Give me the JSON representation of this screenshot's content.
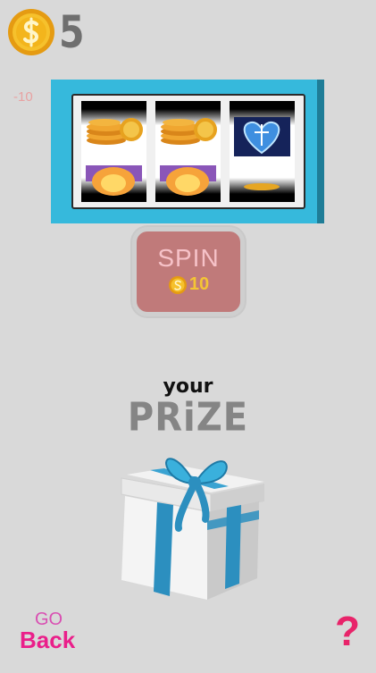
{
  "hud": {
    "coin_count": "5",
    "cost_float": "-10"
  },
  "slot_machine": {
    "reels": [
      {
        "icons": [
          "coins-icon",
          "sunset-icon"
        ]
      },
      {
        "icons": [
          "coins-icon",
          "sunset-icon"
        ]
      },
      {
        "icons": [
          "glowing-heart-icon",
          "coins-icon"
        ]
      }
    ]
  },
  "spin_button": {
    "label": "SPIN",
    "cost": "10"
  },
  "prize": {
    "heading": "your",
    "title": "PRiZE",
    "icon": "gift-box-icon"
  },
  "nav": {
    "go_label": "GO",
    "back_label": "Back",
    "help_label": "?"
  },
  "colors": {
    "background": "#d9d9d9",
    "slot_frame": "#36b9dc",
    "spin_button": "#c07a7a",
    "back_text": "#ea1f8a",
    "help": "#e8246a",
    "coin": "#f4c534"
  }
}
